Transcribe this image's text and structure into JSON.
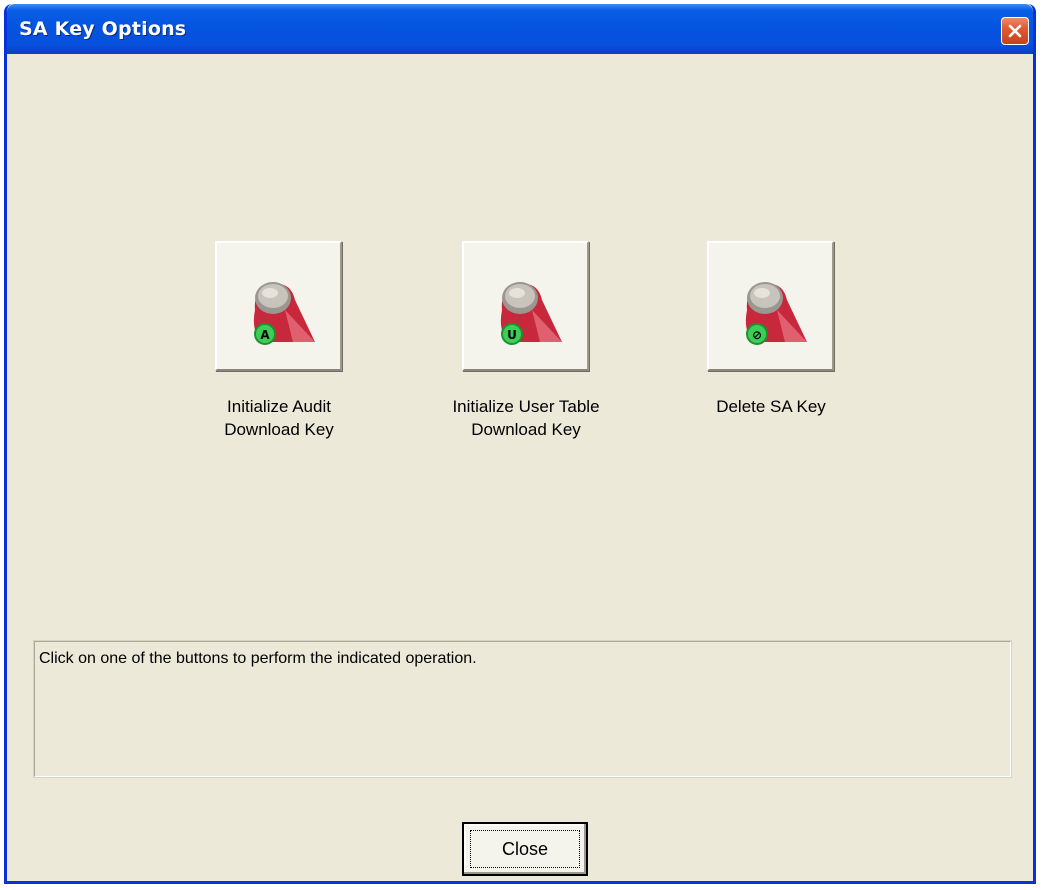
{
  "window": {
    "title": "SA Key Options"
  },
  "buttons": [
    {
      "label": "Initialize Audit\nDownload Key",
      "badge": "A",
      "icon": "ibutton-key-audit-icon"
    },
    {
      "label": "Initialize User Table\nDownload Key",
      "badge": "U",
      "icon": "ibutton-key-user-icon"
    },
    {
      "label": "Delete SA Key",
      "badge": "⊘",
      "icon": "ibutton-key-delete-icon"
    }
  ],
  "status": {
    "message": "Click on one of the buttons to perform the indicated operation."
  },
  "footer": {
    "close_label": "Close"
  },
  "colors": {
    "titlebar": "#0454e0",
    "window_bg": "#ece9d8",
    "key_red": "#c8283c",
    "badge_green": "#2fb84a"
  }
}
